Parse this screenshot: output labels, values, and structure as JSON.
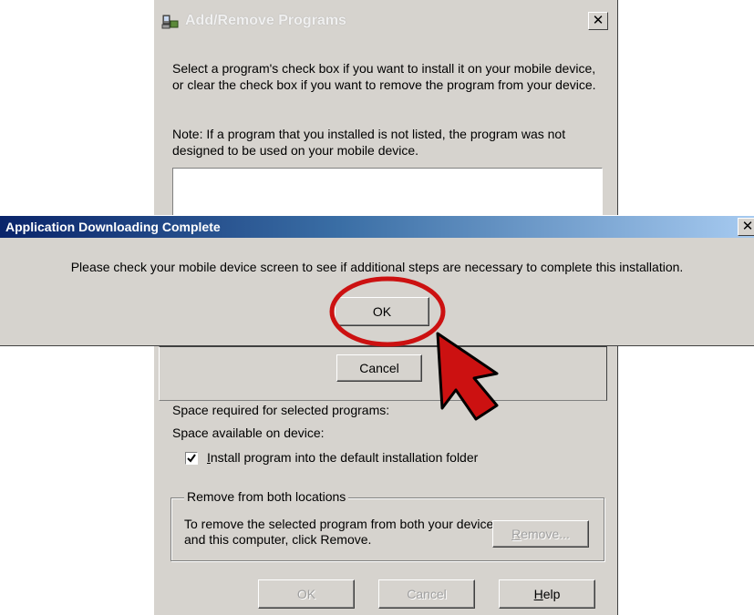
{
  "add_remove": {
    "title": "Add/Remove Programs",
    "instructions": "Select a program's check box if you want to install it on your mobile device, or clear the check box if you want to remove the program from your device.",
    "note": "Note:  If a program that you installed is not listed, the program was not designed to be used on your mobile device.",
    "cancel_label": "Cancel",
    "space_required_label": "Space required for selected programs:",
    "space_available_label": "Space available on device:",
    "install_default": {
      "checked": true,
      "label_prefix": "",
      "label_underlined": "I",
      "label_rest": "nstall program into the default installation folder"
    },
    "remove_group": {
      "legend": "Remove from both locations",
      "text": "To remove the selected program from both your device and this computer, click Remove.",
      "remove_underlined": "R",
      "remove_rest": "emove..."
    },
    "footer": {
      "ok_label": "OK",
      "cancel_label": "Cancel",
      "help_underlined": "H",
      "help_rest": "elp"
    }
  },
  "download_dialog": {
    "title": "Application Downloading Complete",
    "message": "Please check your mobile device screen to see if additional steps are necessary to complete this installation.",
    "ok_label": "OK"
  },
  "close_glyph": "✕",
  "colors": {
    "dialog_bg": "#d6d3ce",
    "titlebar_start": "#0a246a",
    "titlebar_end": "#a6caf0",
    "annotation_red": "#cc1111"
  },
  "icons": {
    "program_icon": "add-remove-programs-icon",
    "pointer": "red-arrow-cursor-icon",
    "highlight": "red-circle-highlight"
  }
}
